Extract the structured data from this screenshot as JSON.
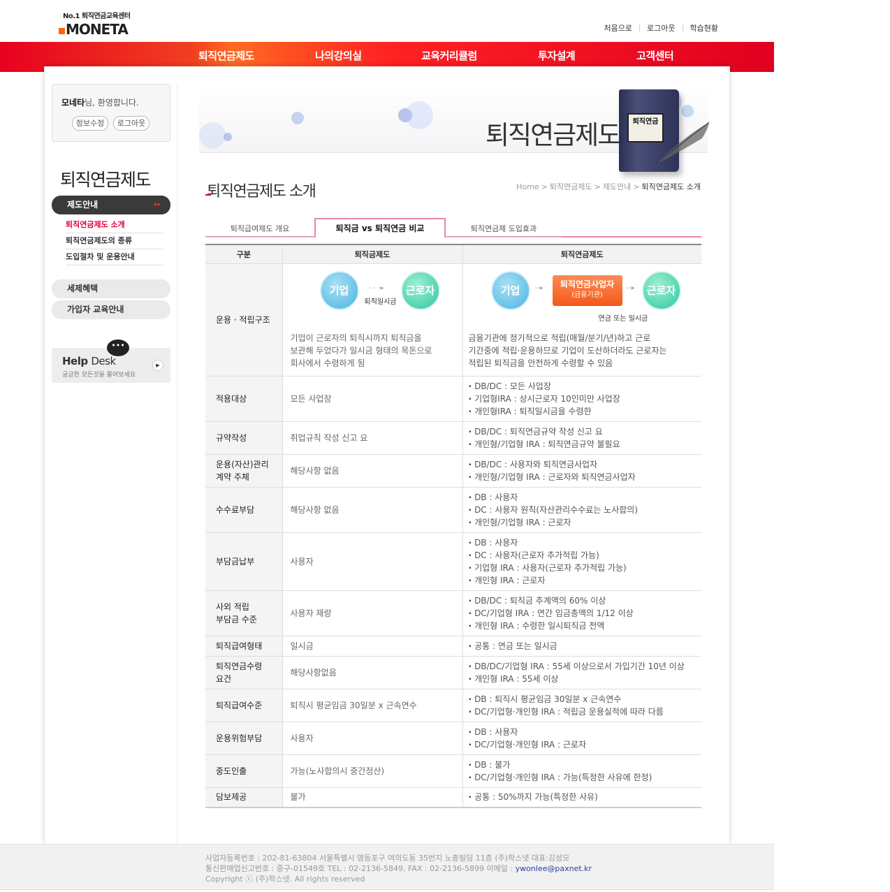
{
  "brand": {
    "tagline": "No.1 퇴직연금교육센터",
    "name": "MONETA"
  },
  "toplinks": [
    "처음으로",
    "로그아웃",
    "학습현황"
  ],
  "gnb": [
    "퇴직연금제도",
    "나의강의실",
    "교육커리큘럼",
    "투자설계",
    "고객센터"
  ],
  "welcome": {
    "name": "모네타",
    "suffix": "님, 환영합니다.",
    "edit_label": "정보수정",
    "logout_label": "로그아웃"
  },
  "lnb": {
    "title": "퇴직연금제도",
    "active": "제도안내",
    "sub": [
      "퇴직연금제도 소개",
      "퇴직연금제도의 종류",
      "도입절차 및 운용안내"
    ],
    "others": [
      "세제혜택",
      "가입자 교육안내"
    ]
  },
  "helpdesk": {
    "title_a": "Help",
    "title_b": "Desk",
    "sub": "궁금한 모든것을 물어보세요",
    "bubble": "•••"
  },
  "visual": {
    "title": "퇴직연금제도",
    "book_label": "퇴직연금"
  },
  "page": {
    "title": "퇴직연금제도 소개"
  },
  "breadcrumb": [
    "Home",
    "퇴직연금제도",
    "제도안내",
    "퇴직연금제도 소개"
  ],
  "tabs": [
    "퇴직급여제도 개요",
    "퇴직금 vs 퇴직연금 비교",
    "퇴직연금제 도입효과"
  ],
  "table": {
    "headers": [
      "구분",
      "퇴직금제도",
      "퇴직연금제도"
    ],
    "diagram": {
      "left_a": "기업",
      "left_b": "근로자",
      "left_arrow": "퇴직일시금",
      "right_a": "기업",
      "right_mid_1": "퇴직연금사업자",
      "right_mid_2": "(금융기관)",
      "right_b": "근로자",
      "right_arrow": "연금 또는 일시금"
    },
    "first_row": {
      "key": "운용 · 적립구조",
      "a_lines": [
        "기업이 근로자의 퇴직시까지 퇴직금을",
        "보관해 두었다가 일시금 형태의 목돈으로",
        "회사에서 수령하게 됨"
      ],
      "b_lines": [
        "금융기관에 정기적으로 적립(매월/분기/년)하고 근로",
        "기간중에 적립·운용하므로 기업이 도산하더라도 근로자는",
        "적립된 퇴직금을 안전하게 수령할 수 있음"
      ]
    },
    "rows": [
      {
        "key": [
          "적용대상"
        ],
        "a": "모든 사업장",
        "b": [
          "DB/DC : 모든 사업장",
          "기업형IRA : 상시근로자 10인미만 사업장",
          "개인형IRA : 퇴직일시금을 수령한"
        ]
      },
      {
        "key": [
          "규약작성"
        ],
        "a": "취업규칙 작성 신고 요",
        "b": [
          "DB/DC : 퇴직연금규약 작성 신고 요",
          "개인형/기업형 IRA : 퇴직연금규약 불필요"
        ]
      },
      {
        "key": [
          "운용(자산)관리",
          "계약 주체"
        ],
        "a": "해당사항 없음",
        "b": [
          "DB/DC : 사용자와 퇴직연금사업자",
          "개인형/기업형 IRA : 근로자와 퇴직연금사업자"
        ]
      },
      {
        "key": [
          "수수료부담"
        ],
        "a": "해당사항 없음",
        "b": [
          "DB : 사용자",
          "DC : 사용자 원칙(자산관리수수료는 노사합의)",
          "개인형/기업형 IRA : 근로자"
        ]
      },
      {
        "key": [
          "부담금납부"
        ],
        "a": "사용자",
        "b": [
          "DB : 사용자",
          "DC : 사용자(근로자 추가적립 가능)",
          "기업형 IRA : 사용자(근로자 추가적립 가능)",
          "개인형 IRA : 근로자"
        ]
      },
      {
        "key": [
          "사외 적립",
          "부담금 수준"
        ],
        "a": "사용자 재량",
        "b": [
          "DB/DC : 퇴직금 추계액의 60% 이상",
          "DC/기업형 IRA : 연간 임금총액의 1/12 이상",
          "개인형 IRA : 수령한 일시퇴직금 전액"
        ]
      },
      {
        "key": [
          "퇴직급여형태"
        ],
        "a": "일시금",
        "b": [
          "공통 : 연금 또는 일시금"
        ]
      },
      {
        "key": [
          "퇴직연금수령",
          "요건"
        ],
        "a": "해당사항없음",
        "b": [
          "DB/DC/기업형 IRA : 55세 이상으로서 가입기간 10년 이상",
          "개인형 IRA : 55세 이상"
        ]
      },
      {
        "key": [
          "퇴직급여수준"
        ],
        "a": "퇴직시 평균임금 30일분 x 근속연수",
        "b": [
          "DB : 퇴직시 평균임금 30일분 x 근속연수",
          "DC/기업형·개인형 IRA : 적립금 운용실적에 따라 다름"
        ]
      },
      {
        "key": [
          "운용위험부담"
        ],
        "a": "사용자",
        "b": [
          "DB : 사용자",
          "DC/기업형·개인형 IRA : 근로자"
        ]
      },
      {
        "key": [
          "중도인출"
        ],
        "a": "가능(노사합의시 중간정산)",
        "b": [
          "DB : 불가",
          "DC/기업형·개인형 IRA : 가능(특정한 사유에 한정)"
        ]
      },
      {
        "key": [
          "담보제공"
        ],
        "a": "불가",
        "b": [
          "공통 : 50%까지 가능(특정한 사유)"
        ]
      }
    ]
  },
  "footer": {
    "line1": "사업자등록번호 : 202-81-63804 서울특별시 영등포구 여의도동 35번지 노총빌딩 11층 (주)팍스넷 대표:김성모",
    "line2": "통신판매업신고번호 : 중구-01549호 TEL : 02-2136-5849, FAX : 02-2136-5899 이메일 : ",
    "email": "ywonlee@paxnet.kr",
    "line3": "Copyright ⓒ (주)팍스넷. All rights reserved"
  },
  "colors": {
    "gnb_red": "#e8001e",
    "accent_pink": "#e4003c",
    "tab_border": "#e888a6",
    "email_link": "#2a3c9a"
  }
}
